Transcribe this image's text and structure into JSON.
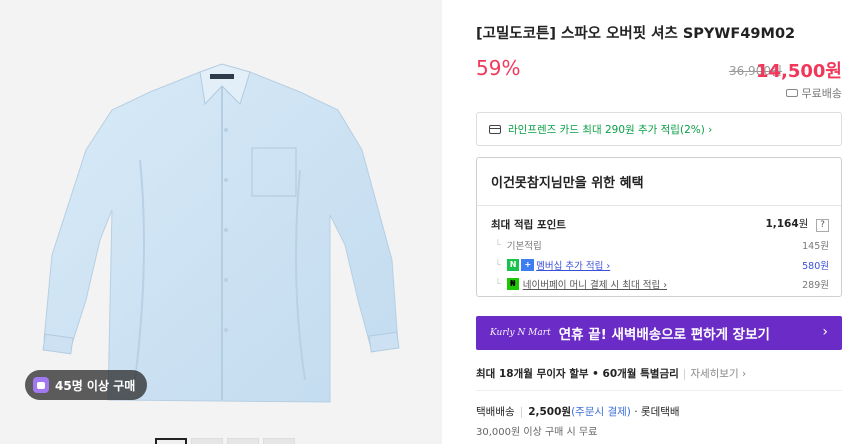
{
  "product": {
    "title": "[고밀도코튼] 스파오 오버핏 셔츠 SPYWF49M02",
    "discount": "59%",
    "original_price": "36,900원",
    "sale_price": "14,500원",
    "free_shipping": "무료배송",
    "purchase_badge": "45명 이상 구매",
    "thumbnail_count": 4
  },
  "card_promo": "라인프렌즈 카드 최대 290원 추가 적립(2%) ›",
  "benefit": {
    "heading": "이건못참지님만을 위한 혜택",
    "max_points_label": "최대 적립 포인트",
    "max_points_value": "1,164",
    "max_points_unit": "원",
    "help": "?",
    "rows": [
      {
        "label": "기본적립",
        "value": "145원"
      },
      {
        "label": "멤버십 추가 적립 ›",
        "value": "580원"
      },
      {
        "label": "네이버페이 머니 결제 시 최대 적립 ›",
        "value": "289원"
      }
    ]
  },
  "kurly": {
    "logo": "Kurly N Mart",
    "text": "연휴 끝! 새벽배송으로 편하게 장보기",
    "arrow": "›"
  },
  "installment": {
    "text": "최대 18개월 무이자 할부 • 60개월 특별금리",
    "more": "자세히보기 ›"
  },
  "shipping": {
    "label": "택배배송",
    "fee": "2,500원",
    "pay_note": "(주문시 결제)",
    "carrier": "· 롯데택배",
    "free_condition": "30,000원 이상 구매 시 무료"
  },
  "colors": {
    "accent_red": "#f2385a",
    "naver_green": "#0a9e45",
    "kurly_purple": "#6b2bc7",
    "shirt_blue": "#cfe3f3"
  }
}
